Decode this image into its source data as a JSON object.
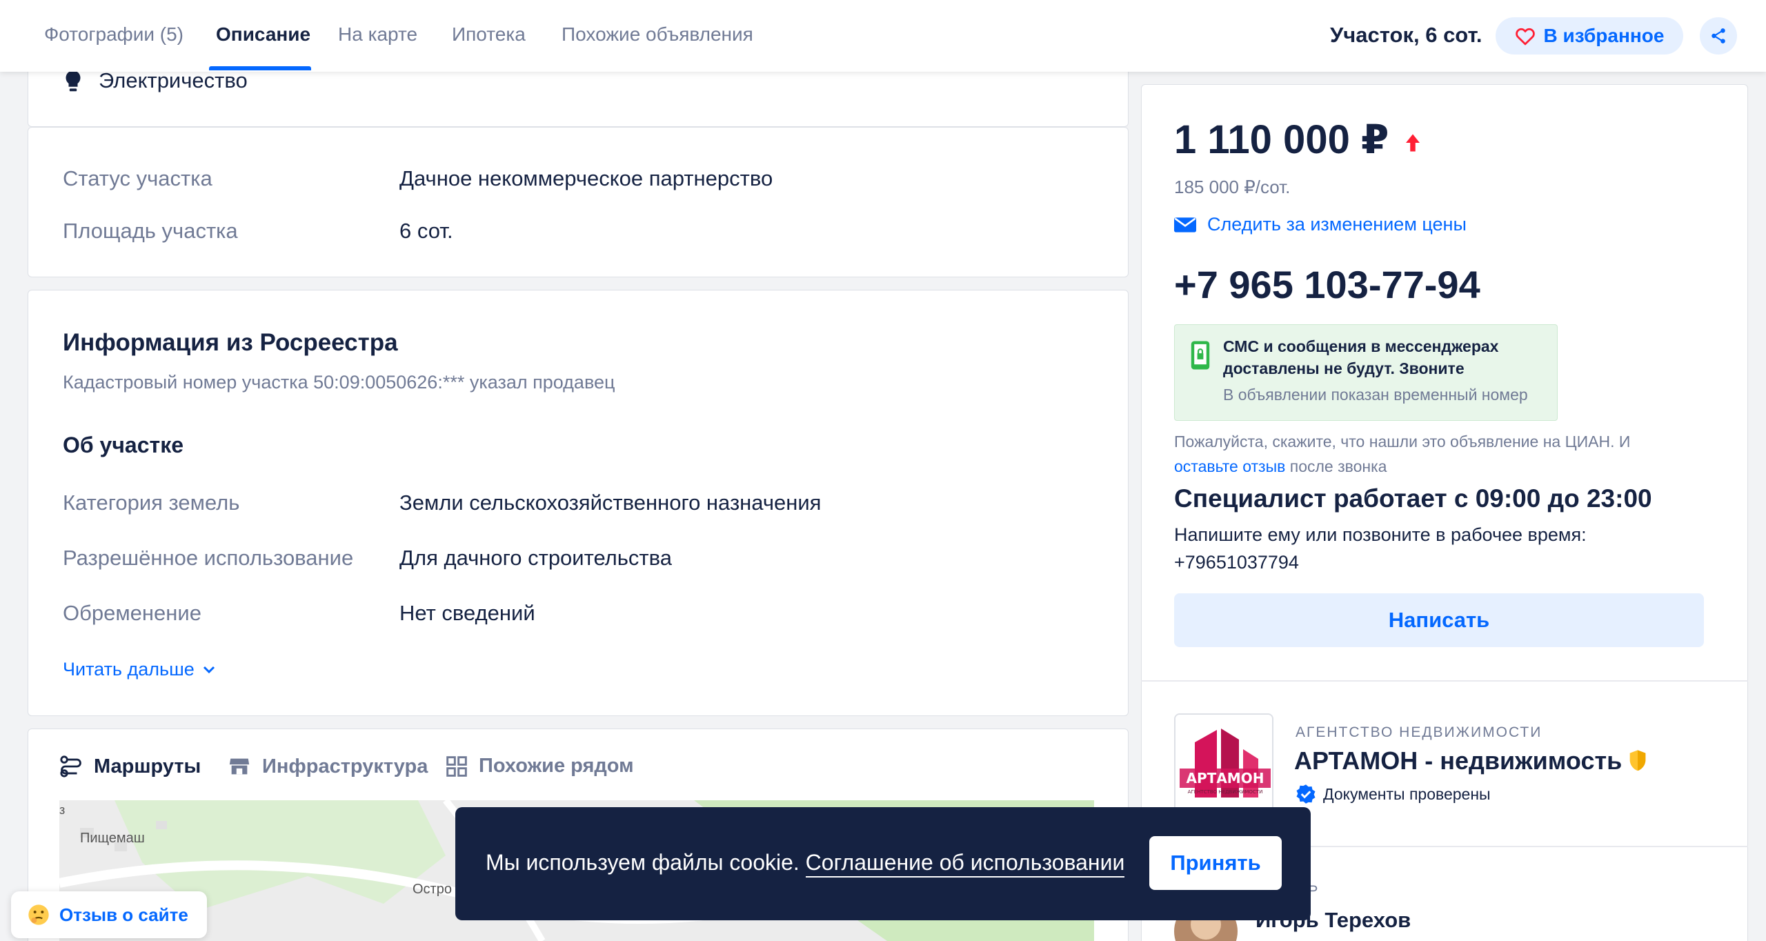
{
  "nav": {
    "tabs": [
      "Фотографии (5)",
      "Описание",
      "На карте",
      "Ипотека",
      "Похожие объявления"
    ],
    "title": "Участок, 6 сот.",
    "favorite_label": "В избранное"
  },
  "utilities": {
    "electricity": "Электричество"
  },
  "plot": {
    "rows": [
      {
        "label": "Статус участка",
        "value": "Дачное некоммерческое партнерство"
      },
      {
        "label": "Площадь участка",
        "value": "6 сот."
      }
    ]
  },
  "rosreestr": {
    "title": "Информация из Росреестра",
    "cadastral": "Кадастровый номер участка 50:09:0050626:*** указал продавец",
    "about_title": "Об участке",
    "rows": [
      {
        "label": "Категория земель",
        "value": "Земли сельскохозяйственного назначения"
      },
      {
        "label": "Разрешённое использование",
        "value": "Для дачного строительства"
      },
      {
        "label": "Обременение",
        "value": "Нет сведений"
      }
    ],
    "read_more": "Читать дальше"
  },
  "map_section": {
    "tabs": [
      "Маршруты",
      "Инфраструктура",
      "Похожие рядом"
    ],
    "labels": [
      "Пищемаш",
      "Остро",
      "з"
    ]
  },
  "offer": {
    "price": "1 110 000 ₽",
    "price_per": "185 000 ₽/сот.",
    "track_price": "Следить за изменением цены",
    "phone": "+7 965 103-77-94",
    "notice_line1": "СМС и сообщения в мессенджерах",
    "notice_line2": "доставлены не будут. Звоните",
    "notice_line3": "В объявлении показан временный номер",
    "cian_text1": "Пожалуйста, скажите, что нашли это объявление на ЦИАН. И",
    "cian_link": "оставьте отзыв",
    "cian_text2": " после звонка",
    "hours_title": "Специалист работает с 09:00 до 23:00",
    "hours_text1": "Напишите ему или позвоните в рабочее время:",
    "hours_text2": "+79651037794",
    "write_button": "Написать"
  },
  "agency": {
    "type": "АГЕНТСТВО НЕДВИЖИМОСТИ",
    "name": "АРТАМОН - недвижимость",
    "verified": "Документы проверены",
    "logo_text": "АРТАМОН",
    "logo_sub": "АГЕНТСТВО НЕДВИЖИМОСТИ"
  },
  "realtor": {
    "role_partial": "ОР",
    "name": "Игорь Терехов"
  },
  "cookie": {
    "text": "Мы используем файлы cookie.",
    "link": "Соглашение об использовании",
    "accept": "Принять"
  },
  "feedback": {
    "label": "Отзыв о сайте"
  },
  "colors": {
    "accent": "#0468ff",
    "text": "#152242",
    "muted": "#707a95",
    "up_arrow": "#ff1f34",
    "green": "#2fb74a"
  }
}
